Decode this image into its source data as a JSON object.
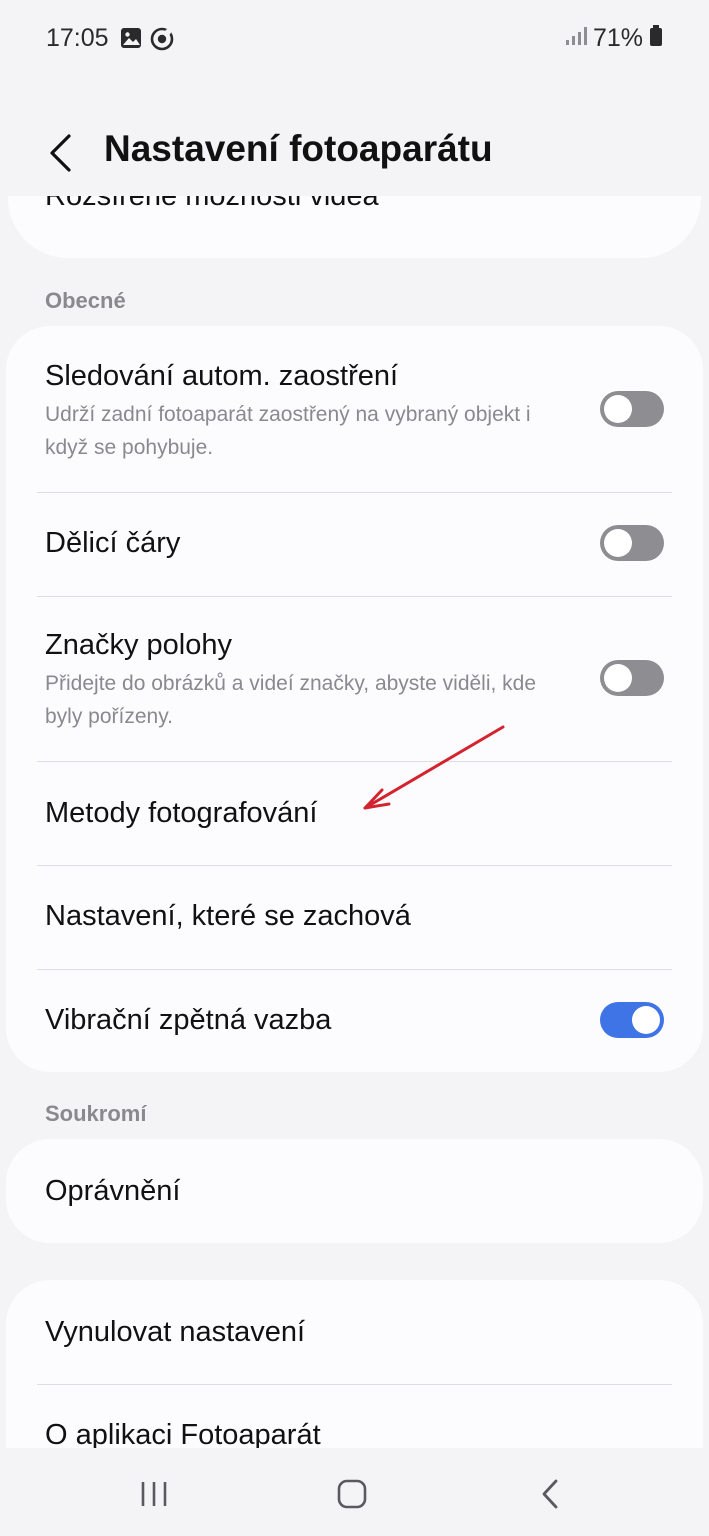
{
  "status_bar": {
    "time": "17:05",
    "battery": "71%"
  },
  "header": {
    "title": "Nastavení fotoaparátu"
  },
  "partial_item": {
    "label": "Rozšířené možnosti videa"
  },
  "sections": {
    "general": {
      "label": "Obecné",
      "items": [
        {
          "title": "Sledování autom. zaostření",
          "description": "Udrží zadní fotoaparát zaostřený na vybraný objekt i když se pohybuje.",
          "toggle": false
        },
        {
          "title": "Dělicí čáry",
          "toggle": false
        },
        {
          "title": "Značky polohy",
          "description": "Přidejte do obrázků a videí značky, abyste viděli, kde byly pořízeny.",
          "toggle": false
        },
        {
          "title": "Metody fotografování"
        },
        {
          "title": "Nastavení, které se zachová"
        },
        {
          "title": "Vibrační zpětná vazba",
          "toggle": true
        }
      ]
    },
    "privacy": {
      "label": "Soukromí",
      "items": [
        {
          "title": "Oprávnění"
        }
      ]
    },
    "other": {
      "items": [
        {
          "title": "Vynulovat nastavení"
        },
        {
          "title": "O aplikaci Fotoaparát"
        }
      ]
    }
  },
  "colors": {
    "accent": "#3f74e6",
    "annotation_arrow": "#d3232f",
    "background": "#f4f4f6",
    "card": "#fcfcfe"
  }
}
